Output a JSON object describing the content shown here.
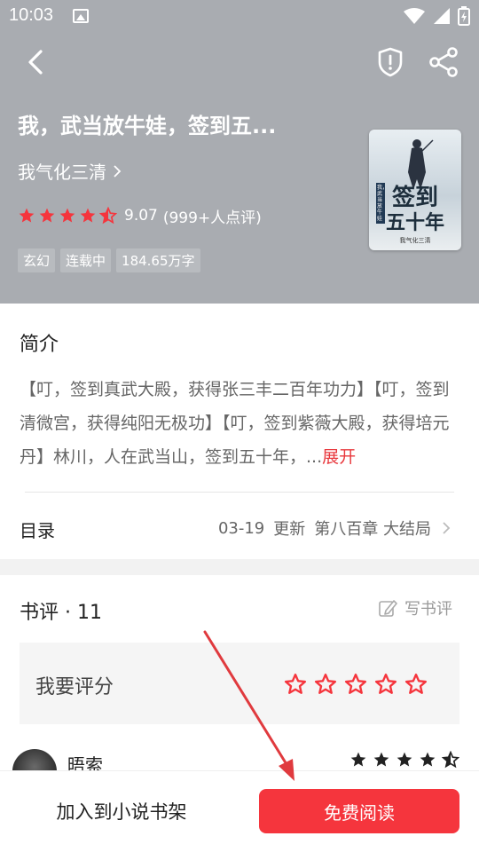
{
  "status": {
    "time": "10:03"
  },
  "book": {
    "title": "我，武当放牛娃，签到五...",
    "author": "我气化三清",
    "rating": 4.5,
    "score": "9.07",
    "rating_count": "(999+人点评)",
    "tags": [
      "玄幻",
      "连载中",
      "184.65万字"
    ],
    "cover": {
      "title_line1": "签到",
      "title_line2": "五十年",
      "author": "我气化三清",
      "tag": "我，武当放牛娃"
    }
  },
  "intro": {
    "heading": "简介",
    "text": "【叮，签到真武大殿，获得张三丰二百年功力】【叮，签到清微宫，获得纯阳无极功】【叮，签到紫薇大殿，获得培元丹】林川，人在武当山，签到五十年，...",
    "expand": "展开"
  },
  "toc": {
    "label": "目录",
    "date": "03-19",
    "update": "更新",
    "chapter": "第八百章 大结局"
  },
  "reviews": {
    "heading": "书评 · 11",
    "write": "写书评",
    "rate_label": "我要评分",
    "comment": {
      "name": "晤索",
      "rating": 5
    }
  },
  "bottom": {
    "add_shelf": "加入到小说书架",
    "read": "免费阅读"
  },
  "colors": {
    "accent": "#f5353d",
    "hero_bg": "#a9acb1",
    "annotation": "#e03a3e"
  }
}
